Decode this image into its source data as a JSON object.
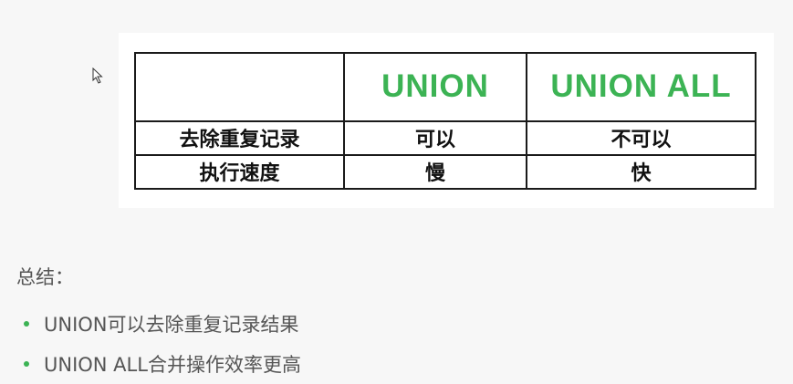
{
  "colors": {
    "accent": "#3cb354",
    "text": "#555555",
    "table_text": "#111111",
    "page_background": "#f7f7f7",
    "table_background": "#ffffff"
  },
  "cursor": {
    "icon": "arrow-pointer-icon"
  },
  "table": {
    "columns": [
      "",
      "UNION",
      "UNION ALL"
    ],
    "rows": [
      [
        "去除重复记录",
        "可以",
        "不可以"
      ],
      [
        "执行速度",
        "慢",
        "快"
      ]
    ]
  },
  "summary": {
    "title": "总结：",
    "bullets": [
      "UNION可以去除重复记录结果",
      "UNION ALL合并操作效率更高"
    ]
  }
}
